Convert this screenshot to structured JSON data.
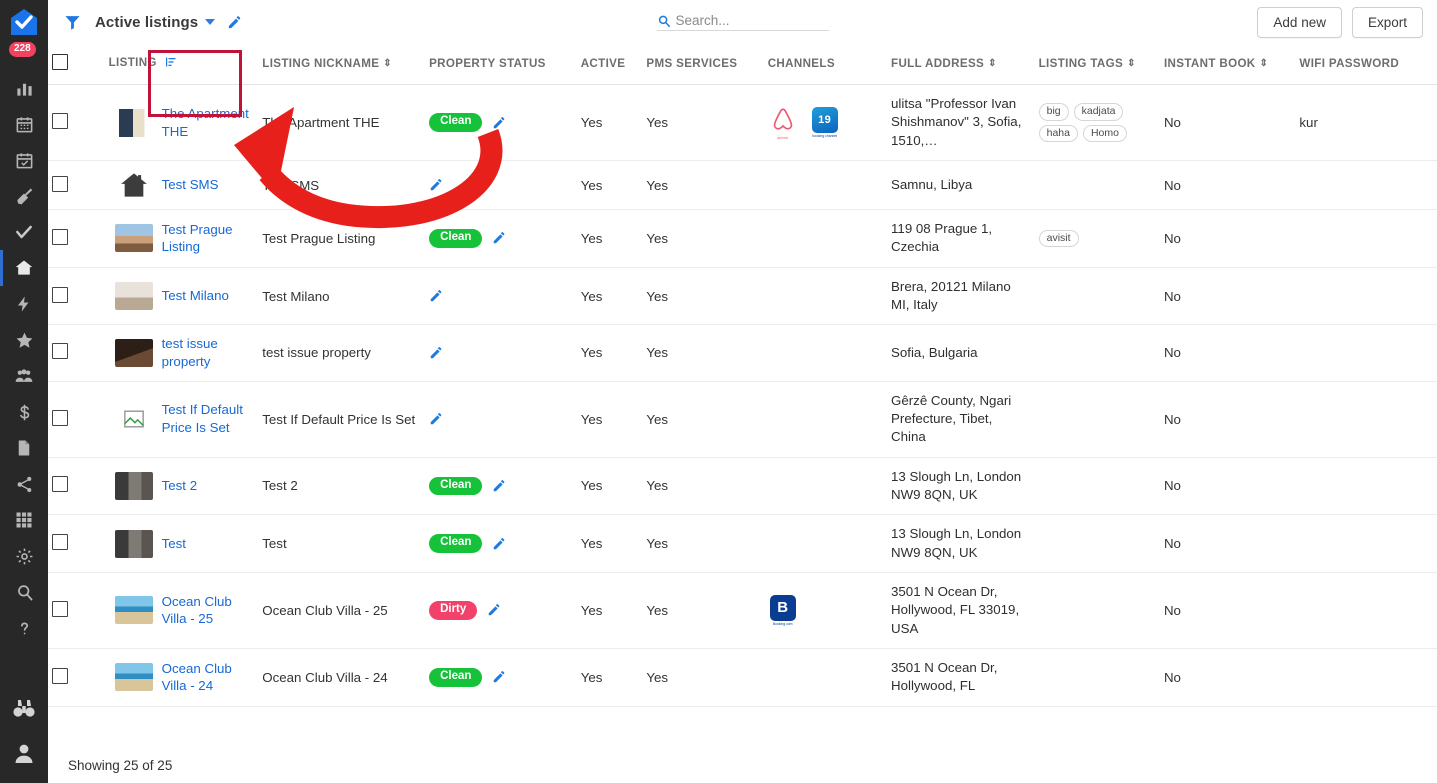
{
  "sidebar": {
    "badge_count": "228",
    "logo_icon": "home-check-logo-icon",
    "items": [
      {
        "icon": "chart-bar-icon",
        "name": "sidebar-item-analytics"
      },
      {
        "icon": "calendar-icon",
        "name": "sidebar-item-calendar"
      },
      {
        "icon": "calendar-check-icon",
        "name": "sidebar-item-bookings"
      },
      {
        "icon": "broom-icon",
        "name": "sidebar-item-cleaning"
      },
      {
        "icon": "check-icon",
        "name": "sidebar-item-tasks"
      },
      {
        "icon": "house-icon",
        "name": "sidebar-item-listings"
      },
      {
        "icon": "lightning-icon",
        "name": "sidebar-item-automations"
      },
      {
        "icon": "star-icon",
        "name": "sidebar-item-reviews"
      },
      {
        "icon": "people-icon",
        "name": "sidebar-item-guests"
      },
      {
        "icon": "dollar-icon",
        "name": "sidebar-item-finance"
      },
      {
        "icon": "document-icon",
        "name": "sidebar-item-documents"
      },
      {
        "icon": "share-icon",
        "name": "sidebar-item-channels"
      },
      {
        "icon": "grid-icon",
        "name": "sidebar-item-apps"
      },
      {
        "icon": "gear-icon",
        "name": "sidebar-item-settings"
      },
      {
        "icon": "search-icon",
        "name": "sidebar-item-search"
      },
      {
        "icon": "question-mark-icon",
        "name": "sidebar-item-help"
      }
    ],
    "bottom_items": [
      {
        "icon": "binoculars-icon",
        "name": "sidebar-item-explore"
      },
      {
        "icon": "user-avatar-icon",
        "name": "sidebar-item-account"
      }
    ]
  },
  "toolbar": {
    "filter_icon": "filter-funnel-icon",
    "view_name": "Active listings",
    "edit_icon": "pencil-icon",
    "dropdown_icon": "chevron-down-icon",
    "search": {
      "value": "",
      "placeholder": "Search...",
      "icon": "search-icon"
    },
    "add_new_label": "Add new",
    "export_label": "Export"
  },
  "table": {
    "columns": [
      {
        "key": "checkbox",
        "label": "",
        "sortable": false
      },
      {
        "key": "listing",
        "label": "LISTING",
        "sortable": true,
        "sort_active": true
      },
      {
        "key": "nickname",
        "label": "LISTING NICKNAME",
        "sortable": true
      },
      {
        "key": "property_status",
        "label": "PROPERTY STATUS",
        "sortable": false
      },
      {
        "key": "active",
        "label": "ACTIVE",
        "sortable": false
      },
      {
        "key": "pms_services",
        "label": "PMS SERVICES",
        "sortable": false
      },
      {
        "key": "channels",
        "label": "CHANNELS",
        "sortable": false
      },
      {
        "key": "full_address",
        "label": "FULL ADDRESS",
        "sortable": true
      },
      {
        "key": "listing_tags",
        "label": "LISTING TAGS",
        "sortable": true
      },
      {
        "key": "instant_book",
        "label": "INSTANT BOOK",
        "sortable": true
      },
      {
        "key": "wifi_password",
        "label": "WIFI PASSWORD",
        "sortable": false
      }
    ],
    "rows": [
      {
        "listing": "The Apartment THE",
        "nickname": "The Apartment THE",
        "status": "Clean",
        "active": "Yes",
        "pms": "Yes",
        "channels": [
          "airbnb",
          "booking19"
        ],
        "address": "ulitsa \"Professor Ivan Shishmanov\" 3, Sofia, 1510,…",
        "tags": [
          "big",
          "kadjata",
          "haha",
          "Homo"
        ],
        "instant_book": "No",
        "wifi": "kur",
        "thumb": "apartment",
        "highlighted": true
      },
      {
        "listing": "Test SMS",
        "nickname": "Test SMS",
        "status": "",
        "active": "Yes",
        "pms": "Yes",
        "channels": [],
        "address": "Samnu, Libya",
        "tags": [],
        "instant_book": "No",
        "wifi": "",
        "thumb": "house-placeholder"
      },
      {
        "listing": "Test Prague Listing",
        "nickname": "Test Prague Listing",
        "status": "Clean",
        "active": "Yes",
        "pms": "Yes",
        "channels": [],
        "address": "119 08 Prague 1, Czechia",
        "tags": [
          "avisit"
        ],
        "instant_book": "No",
        "wifi": "",
        "thumb": "prague"
      },
      {
        "listing": "Test Milano",
        "nickname": "Test Milano",
        "status": "",
        "active": "Yes",
        "pms": "Yes",
        "channels": [],
        "address": "Brera, 20121 Milano MI, Italy",
        "tags": [],
        "instant_book": "No",
        "wifi": "",
        "thumb": "milano"
      },
      {
        "listing": "test issue property",
        "nickname": "test issue property",
        "status": "",
        "active": "Yes",
        "pms": "Yes",
        "channels": [],
        "address": "Sofia, Bulgaria",
        "tags": [],
        "instant_book": "No",
        "wifi": "",
        "thumb": "person"
      },
      {
        "listing": "Test If Default Price Is Set",
        "nickname": "Test If Default Price Is Set",
        "status": "",
        "active": "Yes",
        "pms": "Yes",
        "channels": [],
        "address": "Gêrzê County, Ngari Prefecture, Tibet, China",
        "tags": [],
        "instant_book": "No",
        "wifi": "",
        "thumb": "broken-image"
      },
      {
        "listing": "Test 2",
        "nickname": "Test 2",
        "status": "Clean",
        "active": "Yes",
        "pms": "Yes",
        "channels": [],
        "address": "13 Slough Ln, London NW9 8QN, UK",
        "tags": [],
        "instant_book": "No",
        "wifi": "",
        "thumb": "dark-room"
      },
      {
        "listing": "Test",
        "nickname": "Test",
        "status": "Clean",
        "active": "Yes",
        "pms": "Yes",
        "channels": [],
        "address": "13 Slough Ln, London NW9 8QN, UK",
        "tags": [],
        "instant_book": "No",
        "wifi": "",
        "thumb": "dark-room"
      },
      {
        "listing": "Ocean Club Villa - 25",
        "nickname": "Ocean Club Villa - 25",
        "status": "Dirty",
        "active": "Yes",
        "pms": "Yes",
        "channels": [
          "booking"
        ],
        "address": "3501 N Ocean Dr, Hollywood, FL 33019, USA",
        "tags": [],
        "instant_book": "No",
        "wifi": "",
        "thumb": "ocean"
      },
      {
        "listing": "Ocean Club Villa - 24",
        "nickname": "Ocean Club Villa - 24",
        "status": "Clean",
        "active": "Yes",
        "pms": "Yes",
        "channels": [],
        "address": "3501 N Ocean Dr, Hollywood, FL",
        "tags": [],
        "instant_book": "No",
        "wifi": "",
        "thumb": "ocean"
      }
    ]
  },
  "footer": {
    "showing_text": "Showing 25 of 25"
  },
  "annotation": {
    "highlight_color": "#c1123a",
    "arrow_color": "#e8201c",
    "target": "The Apartment THE"
  },
  "colors": {
    "link": "#1669d6",
    "clean": "#17c23b",
    "dirty": "#f2416b",
    "accent": "#2f7de1",
    "sidebar_bg": "#282828"
  }
}
